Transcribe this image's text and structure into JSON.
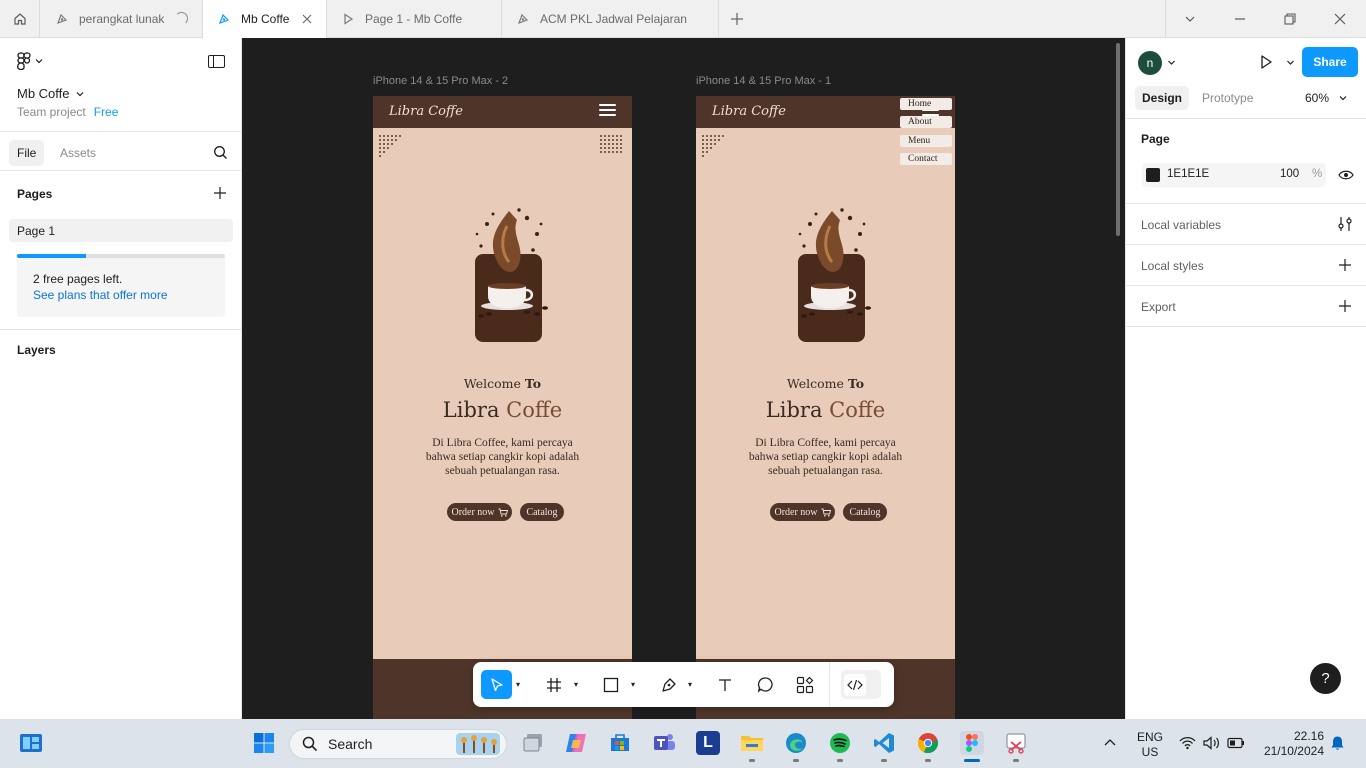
{
  "tabs": [
    {
      "label": "perangkat lunak",
      "state": "loading"
    },
    {
      "label": "Mb Coffe",
      "state": "active"
    },
    {
      "label": "Page 1 - Mb Coffe",
      "state": "prototype"
    },
    {
      "label": "ACM PKL Jadwal Pelajaran",
      "state": "file"
    }
  ],
  "left_panel": {
    "file_name": "Mb Coffe",
    "project": "Team project",
    "plan_badge": "Free",
    "file_tab": "File",
    "assets_tab": "Assets",
    "pages_title": "Pages",
    "pages": [
      "Page 1"
    ],
    "pages_used_fraction": 0.33,
    "free_pages_text": "2 free pages left.",
    "plans_link": "See plans that offer more",
    "layers_title": "Layers"
  },
  "canvas": {
    "frames": [
      {
        "label": "iPhone 14 & 15 Pro Max - 2",
        "logo": "Libra Coffe",
        "welcome_a": "Welcome ",
        "welcome_b": "To",
        "title_a": "Libra ",
        "title_b": "Coffe",
        "description": "Di Libra Coffee, kami percaya bahwa setiap cangkir kopi adalah sebuah petualangan rasa.",
        "btn_order": "Order now",
        "btn_catalog": "Catalog",
        "menu_open": false
      },
      {
        "label": "iPhone 14 & 15 Pro Max - 1",
        "logo": "Libra Coffe",
        "welcome_a": "Welcome ",
        "welcome_b": "To",
        "title_a": "Libra ",
        "title_b": "Coffe",
        "description": "Di Libra Coffee, kami percaya bahwa setiap cangkir kopi adalah sebuah petualangan rasa.",
        "btn_order": "Order now",
        "btn_catalog": "Catalog",
        "menu_open": true,
        "menu": [
          "Home",
          "About",
          "Menu",
          "Contact"
        ]
      }
    ]
  },
  "right_panel": {
    "avatar_letter": "n",
    "share_label": "Share",
    "design_tab": "Design",
    "prototype_tab": "Prototype",
    "zoom": "60%",
    "page_title": "Page",
    "bg_hex": "1E1E1E",
    "bg_opacity": "100",
    "pct": "%",
    "local_variables": "Local variables",
    "local_styles": "Local styles",
    "export": "Export",
    "help": "?"
  },
  "taskbar": {
    "search_placeholder": "Search",
    "lang": "ENG",
    "region": "US",
    "time": "22.16",
    "date": "21/10/2024"
  },
  "colors": {
    "accent": "#0d99ff",
    "coffee_brown": "#4f3529",
    "frame_bg": "#e8cbb9",
    "canvas_bg": "#1e1e1e"
  }
}
